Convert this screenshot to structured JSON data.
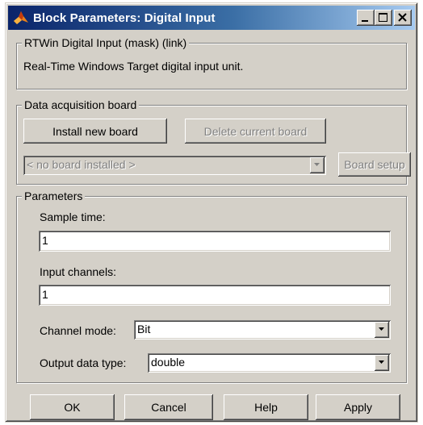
{
  "window": {
    "title": "Block Parameters: Digital Input",
    "colors": {
      "titlebar_start": "#0a246a",
      "titlebar_end": "#a6caf0",
      "face": "#d4d0c8"
    },
    "controls": {
      "minimize": "minimize-icon",
      "maximize": "maximize-icon",
      "close": "close-icon"
    }
  },
  "mask": {
    "group_title": "RTWin Digital Input (mask) (link)",
    "description": "Real-Time Windows Target digital input unit."
  },
  "board": {
    "group_title": "Data acquisition board",
    "install_label": "Install new board",
    "delete_label": "Delete current board",
    "board_select_value": "< no board installed >",
    "setup_label": "Board setup"
  },
  "params": {
    "group_title": "Parameters",
    "sample_time_label": "Sample time:",
    "sample_time_value": "1",
    "input_channels_label": "Input channels:",
    "input_channels_value": "1",
    "channel_mode_label": "Channel mode:",
    "channel_mode_value": "Bit",
    "output_type_label": "Output data type:",
    "output_type_value": "double"
  },
  "footer": {
    "ok_label": "OK",
    "cancel_label": "Cancel",
    "help_label": "Help",
    "apply_label": "Apply"
  }
}
